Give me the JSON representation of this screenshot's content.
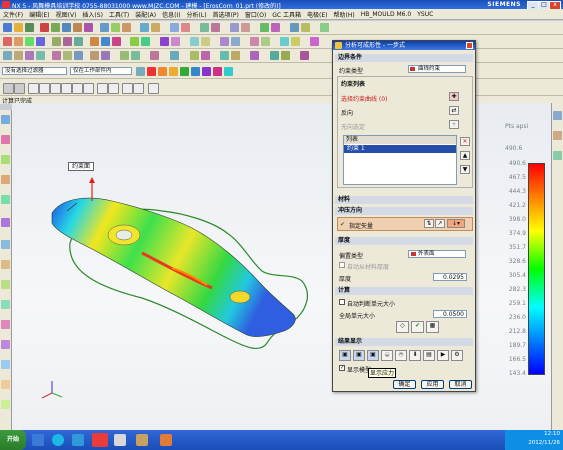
{
  "window": {
    "title": "NX 5 - 风舞模具培训学校  0755-88031000  www.MJZC.COM - 建模 - [ErosCorn_01.prt (修改的)]",
    "brand": "SIEMENS",
    "win_buttons": [
      "_",
      "□",
      "x"
    ]
  },
  "menubar": {
    "items": [
      "文件(F)",
      "编辑(E)",
      "视图(V)",
      "插入(S)",
      "工具(T)",
      "装配(A)",
      "信息(I)",
      "分析(L)",
      "首选项(P)",
      "窗口(O)",
      "GC 工具箱",
      "电极(E)",
      "帮助(H)",
      "HB_MOULD M6.0",
      "YSUC"
    ]
  },
  "selection_bar": {
    "filter_value": "没有选择过滤器",
    "scope_value": "仅在工作部件内"
  },
  "statusline": {
    "text": "计算已完成"
  },
  "viewport": {
    "model_callout": "约束面",
    "legend_unit_text": "Pts apsi",
    "legend_peak": "490.6",
    "legend_values": [
      "490.6",
      "467.5",
      "444.3",
      "421.2",
      "398.0",
      "374.9",
      "351.7",
      "328.6",
      "305.4",
      "282.3",
      "259.1",
      "236.0",
      "212.8",
      "189.7",
      "166.5",
      "143.4"
    ]
  },
  "dialog": {
    "title": "分析可成形性 - 一步式",
    "sections": {
      "boundary": {
        "header": "边界条件",
        "constraint_type_label": "约束类型",
        "constraint_type_value": "曲线约束",
        "constraint_list_header": "约束列表",
        "select_curve_label": "选择约束曲线 (0)",
        "direction_label": "反向",
        "specify_label": "无向选定",
        "list_header": "列表",
        "list_item": "约束 1"
      },
      "material": {
        "header": "材料"
      },
      "direction": {
        "header": "冲压方向",
        "vector_label": "指定矢量"
      },
      "thickness": {
        "header": "厚度",
        "type_label": "偏置类型",
        "type_value": "外表面",
        "from_material_label": "自动从材料厚度",
        "thickness_label": "厚度",
        "thickness_value": "0.0295"
      },
      "compute": {
        "header": "计算",
        "auto_label": "自动判断单元大小",
        "global_size_label": "全局单元大小",
        "global_size_value": "0.0500"
      },
      "results": {
        "header": "结果显示",
        "show_model_label": "显示模型"
      }
    },
    "buttons": {
      "ok": "确定",
      "apply": "应用",
      "cancel": "取消"
    },
    "tooltip": "显示应力"
  },
  "taskbar": {
    "start_label": "开始",
    "time": "12:10",
    "date": "2012/11/26"
  }
}
